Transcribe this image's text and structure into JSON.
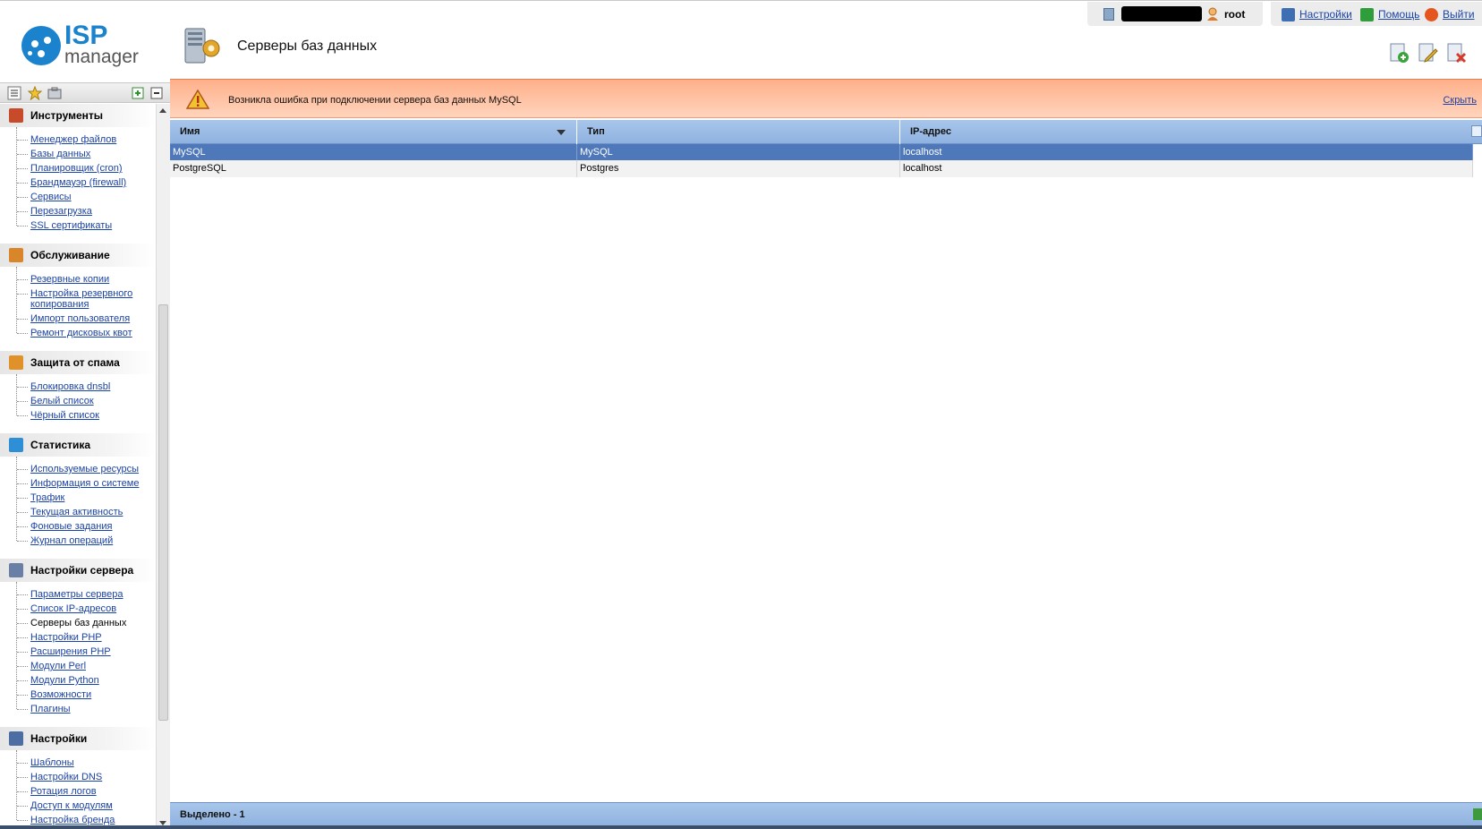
{
  "header": {
    "logo_top": "ISP",
    "logo_bottom": "manager",
    "page_title": "Серверы баз данных",
    "user": {
      "name": "root"
    },
    "links": [
      {
        "label": "Настройки",
        "icon": "settings-icon",
        "color": "#3f6fb3"
      },
      {
        "label": "Помощь",
        "icon": "help-icon",
        "color": "#2f9e3a"
      },
      {
        "label": "Выйти",
        "icon": "logout-icon",
        "color": "#e5551e"
      }
    ],
    "toolbar": [
      "add-icon",
      "edit-icon",
      "delete-icon"
    ]
  },
  "nav": {
    "groups": [
      {
        "title": "Инструменты",
        "icon": "tools-icon",
        "color": "#c74a2a",
        "items": [
          "Менеджер файлов",
          "Базы данных",
          "Планировщик (cron)",
          "Брандмауэр (firewall)",
          "Сервисы",
          "Перезагрузка",
          "SSL сертификаты"
        ]
      },
      {
        "title": "Обслуживание",
        "icon": "maintenance-icon",
        "color": "#d9862a",
        "items": [
          "Резервные копии",
          "Настройка резервного копирования",
          "Импорт пользователя",
          "Ремонт дисковых квот"
        ]
      },
      {
        "title": "Защита от спама",
        "icon": "shield-icon",
        "color": "#e0912a",
        "items": [
          "Блокировка dnsbl",
          "Белый список",
          "Чёрный список"
        ]
      },
      {
        "title": "Статистика",
        "icon": "stats-icon",
        "color": "#2f8fd6",
        "items": [
          "Используемые ресурсы",
          "Информация о системе",
          "Трафик",
          "Текущая активность",
          "Фоновые задания",
          "Журнал операций"
        ]
      },
      {
        "title": "Настройки сервера",
        "icon": "server-settings-icon",
        "color": "#6a7fa5",
        "items": [
          "Параметры сервера",
          "Список IP-адресов",
          "Серверы баз данных",
          "Настройки PHP",
          "Расширения PHP",
          "Модули Perl",
          "Модули Python",
          "Возможности",
          "Плагины"
        ]
      },
      {
        "title": "Настройки",
        "icon": "settings-icon",
        "color": "#4c6ea3",
        "items": [
          "Шаблоны",
          "Настройки DNS",
          "Ротация логов",
          "Доступ к модулям",
          "Настройка бренда"
        ]
      }
    ],
    "active_item": "Серверы баз данных"
  },
  "alert": {
    "message": "Возникла ошибка при подключении сервера баз данных MySQL",
    "hide_label": "Скрыть"
  },
  "table": {
    "columns": [
      "Имя",
      "Тип",
      "IP-адрес"
    ],
    "rows": [
      [
        "MySQL",
        "MySQL",
        "localhost"
      ],
      [
        "PostgreSQL",
        "Postgres",
        "localhost"
      ]
    ],
    "selected_row": 0
  },
  "footer": {
    "selected_label": "Выделено - 1"
  },
  "colors": {
    "accent": "#4e78b9",
    "header_bg": "#a9c6ea",
    "alert_bg": "#ffb08a",
    "link": "#1a43a8"
  }
}
